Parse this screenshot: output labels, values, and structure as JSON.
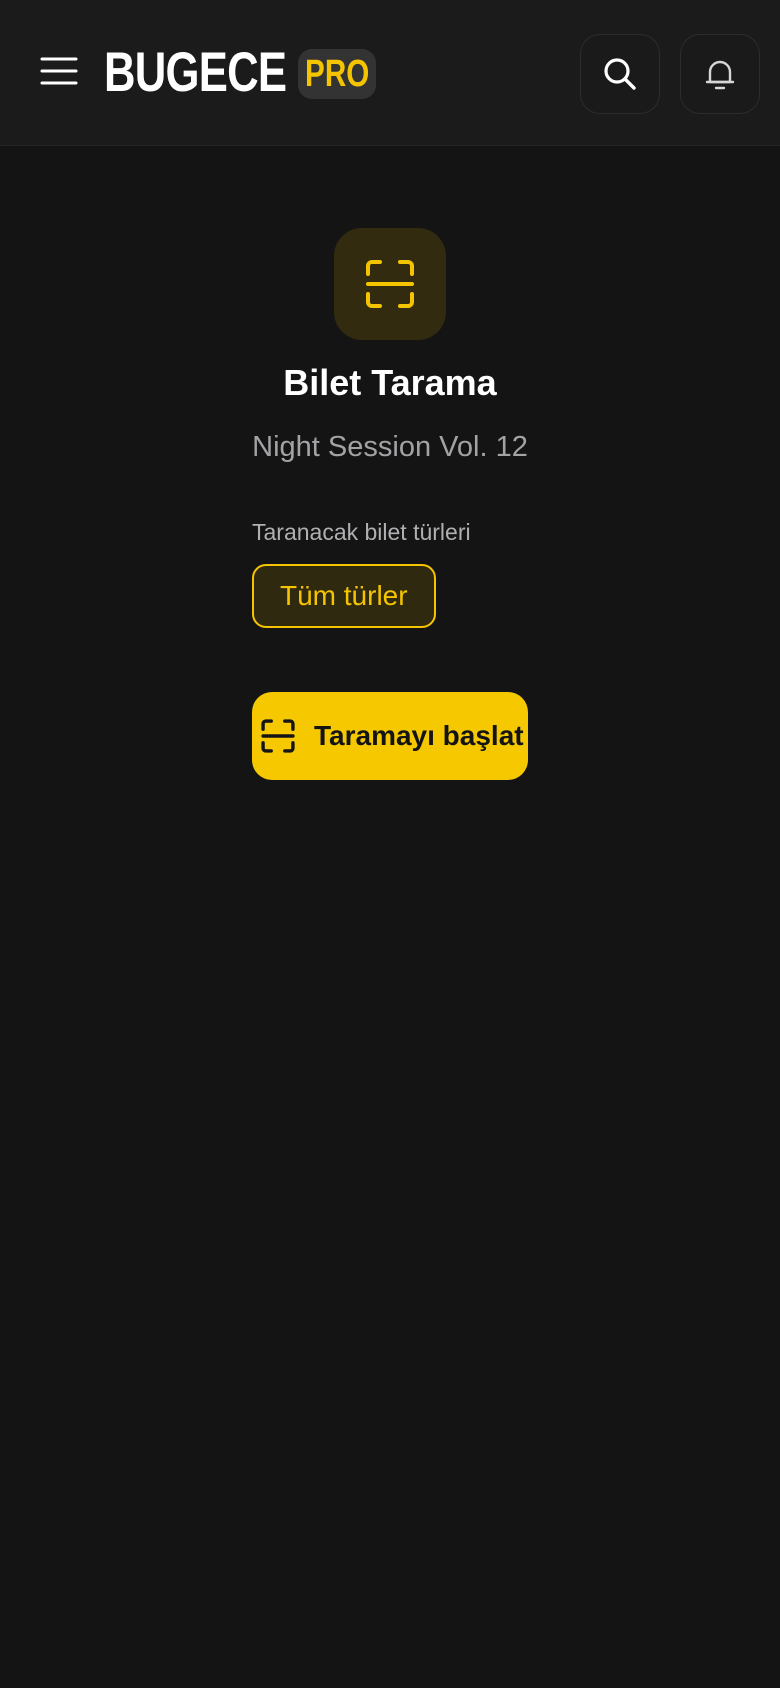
{
  "header": {
    "brand": "BUGECE",
    "badge": "PRO",
    "icons": {
      "menu": "menu-icon",
      "search": "search-icon",
      "notifications": "bell-icon"
    }
  },
  "main": {
    "icon": "scan-icon",
    "title": "Bilet Tarama",
    "event_name": "Night Session Vol. 12",
    "ticket_types_label": "Taranacak bilet türleri",
    "ticket_types": [
      {
        "label": "Tüm türler",
        "selected": true
      }
    ],
    "start_button": {
      "icon": "scan-icon",
      "label": "Taramayı başlat"
    }
  },
  "colors": {
    "accent": "#f5c400",
    "background": "#141414",
    "header_background": "#1b1b1b",
    "text_primary": "#ffffff",
    "text_secondary": "#a3a3a6"
  }
}
